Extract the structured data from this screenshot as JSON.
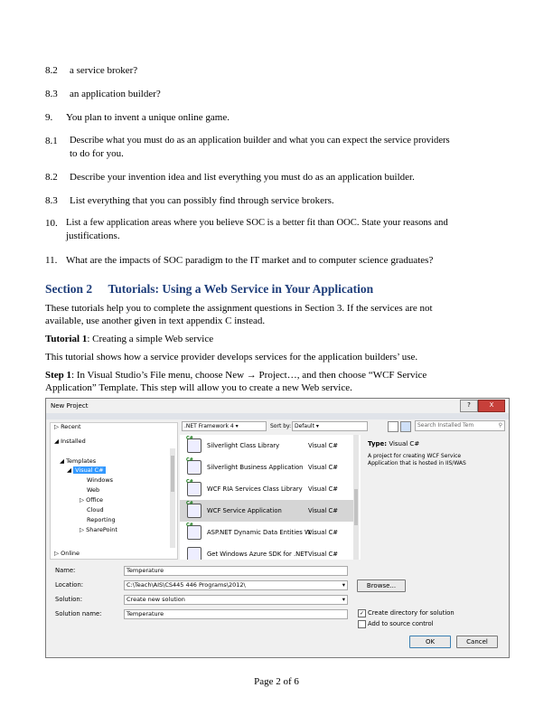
{
  "questions": [
    {
      "num": "8.2",
      "text": "a service broker?"
    },
    {
      "num": "8.3",
      "text": "an application builder?"
    },
    {
      "num": "9.",
      "text": "You plan to invent a unique online game."
    },
    {
      "num": "8.1",
      "text": "Describe what you must do as an application builder and what you can expect the service providers",
      "text2": "to do for you."
    },
    {
      "num": "8.2",
      "text": "Describe your invention idea and list everything you must do as an application builder."
    },
    {
      "num": "8.3",
      "text": "List everything that you can possibly find through service brokers."
    },
    {
      "num": "10.",
      "text": "List a few application areas where you believe SOC is a better fit than OOC. State your reasons and",
      "text2": "justifications."
    },
    {
      "num": "11.",
      "text": "What are the impacts of SOC paradigm to the IT market and to computer science graduates?"
    }
  ],
  "section": {
    "number": "Section 2",
    "title": "Tutorials: Using a Web Service in Your Application",
    "intro1": "These tutorials help you to complete the assignment questions in Section 3. If the services are not",
    "intro2": "available, use another given in text appendix C instead.",
    "tutorial_label": "Tutorial 1",
    "tutorial_title": ": Creating a simple Web service",
    "tutorial_desc": "This tutorial shows how a service provider develops services for the application builders’ use.",
    "step_label": "Step 1",
    "step_text1": ": In Visual Studio’s File menu, choose New → Project…, and then choose “WCF Service",
    "step_text2": "Application” Template. This step will allow you to create a new Web service."
  },
  "dialog": {
    "title": "New Project",
    "help_btn": "?",
    "close_btn": "X",
    "framework": ".NET Framework 4",
    "sort_label": "Sort by:",
    "sort_value": "Default",
    "search_placeholder": "Search Installed Tem",
    "tree": {
      "recent": "Recent",
      "installed": "Installed",
      "templates": "Templates",
      "visual_cs": "Visual C#",
      "windows": "Windows",
      "web": "Web",
      "office": "Office",
      "cloud": "Cloud",
      "reporting": "Reporting",
      "sharepoint": "SharePoint",
      "online": "Online"
    },
    "templates": [
      {
        "name": "Silverlight Class Library",
        "lang": "Visual C#"
      },
      {
        "name": "Silverlight Business Application",
        "lang": "Visual C#"
      },
      {
        "name": "WCF RIA Services Class Library",
        "lang": "Visual C#"
      },
      {
        "name": "WCF Service Application",
        "lang": "Visual C#"
      },
      {
        "name": "ASP.NET Dynamic Data Entities W...",
        "lang": "Visual C#"
      },
      {
        "name": "Get Windows Azure SDK for .NET",
        "lang": "Visual C#"
      }
    ],
    "info_type_label": "Type:",
    "info_type_value": "Visual C#",
    "info_desc1": "A project for creating WCF Service",
    "info_desc2": "Application that is hosted in IIS/WAS",
    "form": {
      "name_label": "Name:",
      "name_value": "Temperature",
      "location_label": "Location:",
      "location_value": "C:\\Teach\\AIS\\CS445 446 Programs\\2012\\",
      "solution_label": "Solution:",
      "solution_value": "Create new solution",
      "solution_name_label": "Solution name:",
      "solution_name_value": "Temperature",
      "browse": "Browse...",
      "create_dir": "Create directory for solution",
      "add_source": "Add to source control",
      "ok": "OK",
      "cancel": "Cancel"
    }
  },
  "footer": "Page 2 of 6"
}
